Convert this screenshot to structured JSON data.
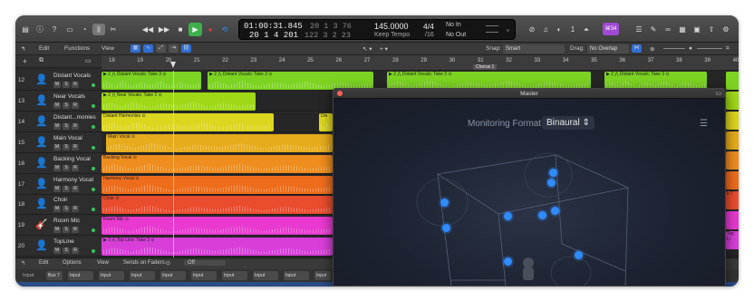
{
  "transport": {
    "position_time": "01:00:31.845",
    "position_bars": "20  1  4 201",
    "end_time": "20  1  3  76",
    "end_bars": "122  3  2  23",
    "tempo": "145.0000",
    "tempo_mode": "Keep Tempo",
    "signature": "4/4",
    "division": "/16",
    "midi_in": "No In",
    "midi_out": "No Out",
    "cpu_badge": "⌘34"
  },
  "edit_bar": {
    "edit": "Edit",
    "functions": "Functions",
    "view": "View",
    "snap_label": "Snap:",
    "snap_value": "Smart",
    "drag_label": "Drag:",
    "drag_value": "No Overlap"
  },
  "ruler": {
    "ticks": [
      "18",
      "19",
      "20",
      "21",
      "22",
      "23",
      "24",
      "25",
      "26",
      "27",
      "28",
      "29",
      "30",
      "31",
      "32",
      "33",
      "34",
      "35",
      "36",
      "37",
      "38",
      "39",
      "40"
    ],
    "marker": "Chorus 1"
  },
  "tracks": [
    {
      "num": "12",
      "name": "Distant Vocals",
      "icon": "👤",
      "icon_color": "#7dd321"
    },
    {
      "num": "13",
      "name": "Near Vocals",
      "icon": "👤",
      "icon_color": "#9fd816"
    },
    {
      "num": "14",
      "name": "Distant...monies",
      "icon": "👤",
      "icon_color": "#dcd61e"
    },
    {
      "num": "15",
      "name": "Main Vocal",
      "icon": "👤",
      "icon_color": "#e6ac1c"
    },
    {
      "num": "16",
      "name": "Backing Vocal",
      "icon": "👤",
      "icon_color": "#ef8d1e"
    },
    {
      "num": "17",
      "name": "Harmony Vocal",
      "icon": "👤",
      "icon_color": "#ee6d1c"
    },
    {
      "num": "18",
      "name": "Choir",
      "icon": "👤",
      "icon_color": "#ea4c2e"
    },
    {
      "num": "19",
      "name": "Room Mic",
      "icon": "🎸",
      "icon_color": "#e83ad0"
    },
    {
      "num": "20",
      "name": "TopLine",
      "icon": "👤",
      "icon_color": "#d83fd9"
    }
  ],
  "regions": {
    "r12a": "▶ 2 ⋀ Distant Vocals: Take 3 ⊙",
    "r12b": "▶ 2 ⋀ Distant Vocals: Take 3 ⊙",
    "r12c": "▶ 2 ⋀ Distant Vocals: Take 3 ⊙",
    "r12d": "▶ 2 ⋀ Distant Vocals: Take 3 ⊙",
    "r13": "▶ 2 ⋀ Near Vocals: Take 2 ⊙",
    "r14": "Distant Harmonies ⊙",
    "r14b": "Dis",
    "r15": "Main Vocal ⊙",
    "r16": "Backing Vocal ⊙",
    "r17": "Harmony Vocal ⊙",
    "r18": "Choir ⊙",
    "r18r": "ir.7",
    "r19": "Room Mic ⊙",
    "r20": "▶ 3 ⋀ Top Line: Take 3 ⊙",
    "r20r": "Top Li"
  },
  "mixer_bar": {
    "edit": "Edit",
    "options": "Options",
    "view": "View",
    "sends": "Sends on Faders:",
    "sends_value": "Off",
    "input": "Input",
    "bus": "Bus 7"
  },
  "master": {
    "title": "Master",
    "monitoring_label": "Monitoring Format:",
    "monitoring_value": "Binaural"
  }
}
